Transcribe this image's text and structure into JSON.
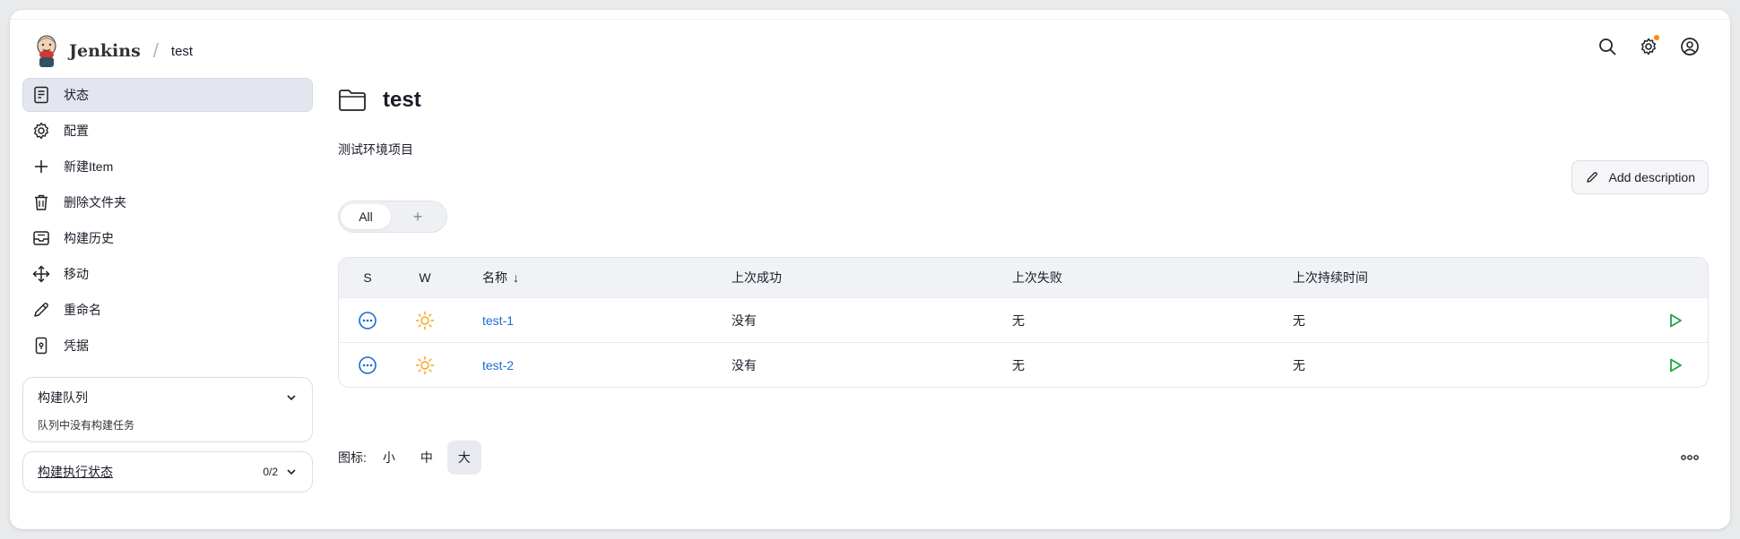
{
  "header": {
    "brand": "Jenkins",
    "separator": "/",
    "breadcrumb": "test"
  },
  "sidebar": {
    "tasks": [
      {
        "label": "状态",
        "icon": "document-icon"
      },
      {
        "label": "配置",
        "icon": "gear-icon"
      },
      {
        "label": "新建Item",
        "icon": "plus-icon"
      },
      {
        "label": "删除文件夹",
        "icon": "trash-icon"
      },
      {
        "label": "构建历史",
        "icon": "inbox-icon"
      },
      {
        "label": "移动",
        "icon": "move-icon"
      },
      {
        "label": "重命名",
        "icon": "pencil-icon"
      },
      {
        "label": "凭据",
        "icon": "phone-key-icon"
      }
    ],
    "build_queue": {
      "title": "构建队列",
      "empty_text": "队列中没有构建任务"
    },
    "executor_status": {
      "title": "构建执行状态",
      "count": "0/2"
    }
  },
  "main": {
    "title": "test",
    "description": "测试环境项目",
    "add_description": "Add description",
    "tabs": {
      "all": "All",
      "add": "+"
    },
    "table": {
      "headers": {
        "s": "S",
        "w": "W",
        "name": "名称",
        "name_sort": "↓",
        "last_success": "上次成功",
        "last_failure": "上次失败",
        "last_duration": "上次持续时间"
      },
      "rows": [
        {
          "name": "test-1",
          "last_success": "没有",
          "last_failure": "无",
          "last_duration": "无"
        },
        {
          "name": "test-2",
          "last_success": "没有",
          "last_failure": "无",
          "last_duration": "无"
        }
      ]
    },
    "legend": {
      "label": "图标:",
      "sizes": [
        "小",
        "中",
        "大"
      ],
      "selected": "大"
    }
  },
  "colors": {
    "accent_blue": "#1a6bd6",
    "run_green": "#1ea446",
    "weather_orange": "#f5a623",
    "notification_dot": "#ff8a00"
  }
}
